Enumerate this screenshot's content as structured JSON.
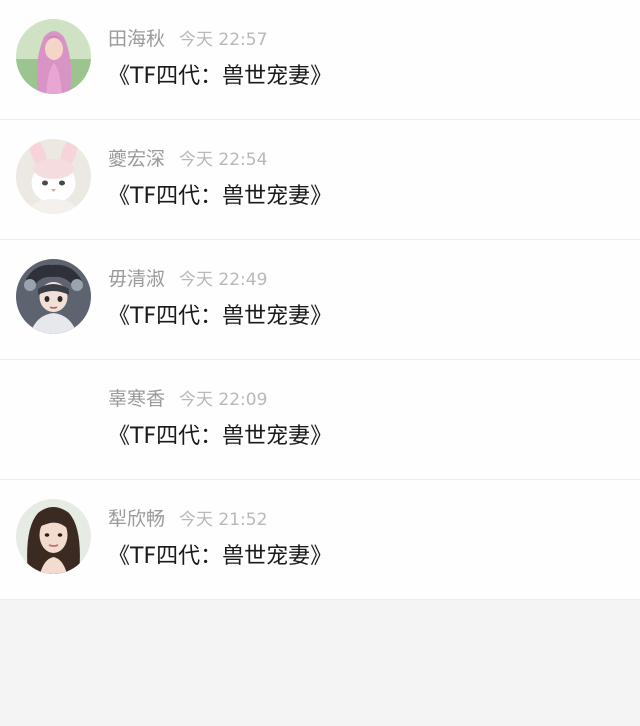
{
  "feed": {
    "items": [
      {
        "name": "田海秋",
        "time": "今天 22:57",
        "message": "《TF四代：兽世宠妻》",
        "avatar": "pink-haired-girl-avatar"
      },
      {
        "name": "夔宏深",
        "time": "今天 22:54",
        "message": "《TF四代：兽世宠妻》",
        "avatar": "white-cat-bunny-ears-avatar"
      },
      {
        "name": "毋清淑",
        "time": "今天 22:49",
        "message": "《TF四代：兽世宠妻》",
        "avatar": "anime-character-avatar"
      },
      {
        "name": "辜寒香",
        "time": "今天 22:09",
        "message": "《TF四代：兽世宠妻》",
        "avatar": null
      },
      {
        "name": "犁欣畅",
        "time": "今天 21:52",
        "message": "《TF四代：兽世宠妻》",
        "avatar": "dark-haired-woman-avatar"
      }
    ]
  },
  "colors": {
    "name": "#9a9a9a",
    "time": "#b8b8b8",
    "message": "#1a1a1a",
    "divider": "#ececec",
    "background": "#f5f4f4"
  }
}
